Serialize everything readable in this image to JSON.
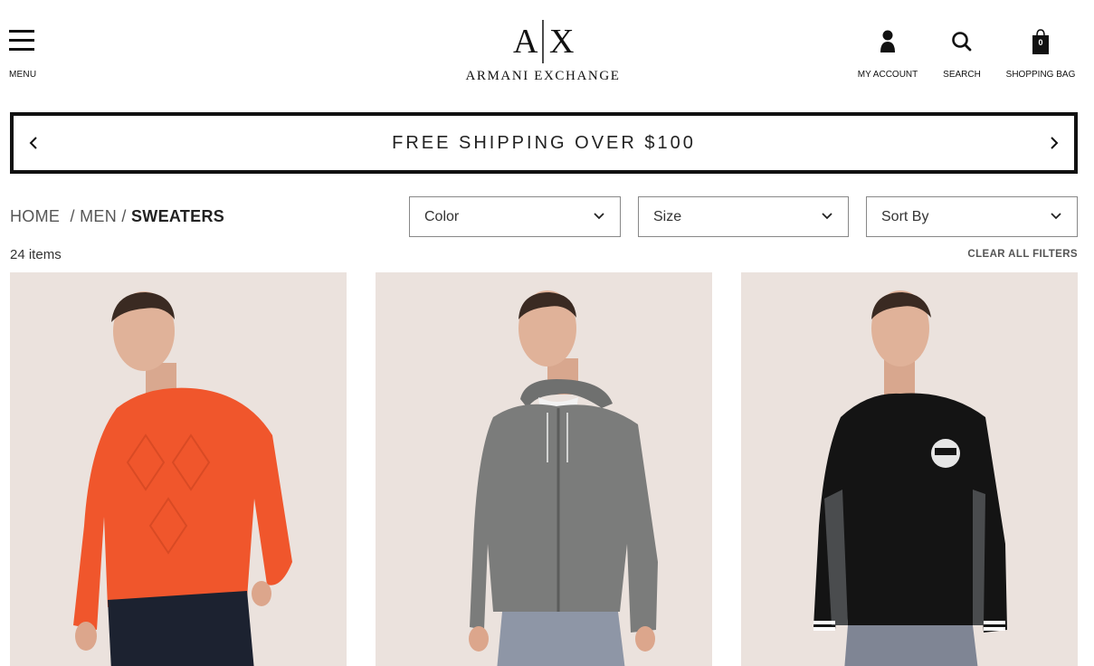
{
  "header": {
    "menu_label": "MENU",
    "logo_letters": "A|X",
    "brand": "ARMANI EXCHANGE",
    "account_label": "MY ACCOUNT",
    "search_label": "SEARCH",
    "bag_label": "SHOPPING BAG",
    "bag_count": "0"
  },
  "promo": {
    "text": "FREE SHIPPING OVER $100"
  },
  "breadcrumb": {
    "home": "HOME",
    "sep1": "/",
    "men": "MEN",
    "sep2": "/",
    "current": "SWEATERS"
  },
  "filters": {
    "color": "Color",
    "size": "Size",
    "sort": "Sort By"
  },
  "results": {
    "count": "24 items",
    "clear": "CLEAR ALL FILTERS"
  },
  "products": [
    {
      "icon": "orange-sweater-model",
      "sweater_color": "#f0562c",
      "pants_color": "#1c2230"
    },
    {
      "icon": "grey-zip-hoodie-model",
      "sweater_color": "#7b7c7b",
      "pants_color": "#8e96a6"
    },
    {
      "icon": "black-patch-sweater-model",
      "sweater_color": "#141414",
      "pants_color": "#7f8594"
    }
  ],
  "colors": {
    "background": "#ffffff",
    "card_bg": "#ebe2dd",
    "text": "#222222"
  }
}
